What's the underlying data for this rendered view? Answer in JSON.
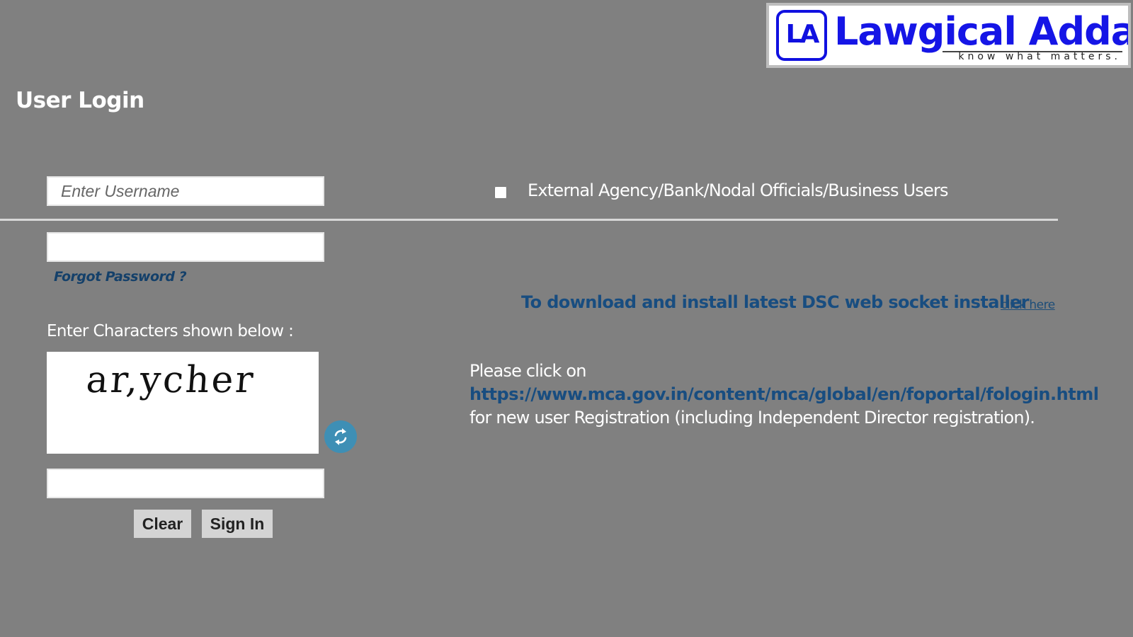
{
  "logo": {
    "mark": "LA",
    "brand": "Lawgical Adda",
    "tagline": "know what matters."
  },
  "page": {
    "title": "User Login"
  },
  "login_form": {
    "username_placeholder": "Enter Username",
    "username_value": "",
    "password_value": "",
    "forgot_password": "Forgot Password ?",
    "captcha_label": "Enter Characters shown below :",
    "captcha_text": "ar,ycher",
    "captcha_value": "",
    "refresh_icon": "refresh-icon",
    "clear_label": "Clear",
    "signin_label": "Sign In"
  },
  "external_users": {
    "checked": false,
    "label": "External Agency/Bank/Nodal Officials/Business Users"
  },
  "dsc": {
    "text": "To download and install latest DSC web socket installer",
    "link_label": "click here"
  },
  "registration": {
    "prefix": "Please click on",
    "link": "https://www.mca.gov.in/content/mca/global/en/foportal/fologin.html",
    "suffix": "for new user Registration (including Independent Director registration)."
  },
  "colors": {
    "background": "#808080",
    "link_blue": "#184d80",
    "brand_blue": "#1515e6",
    "refresh_blue": "#3e8fb5"
  }
}
